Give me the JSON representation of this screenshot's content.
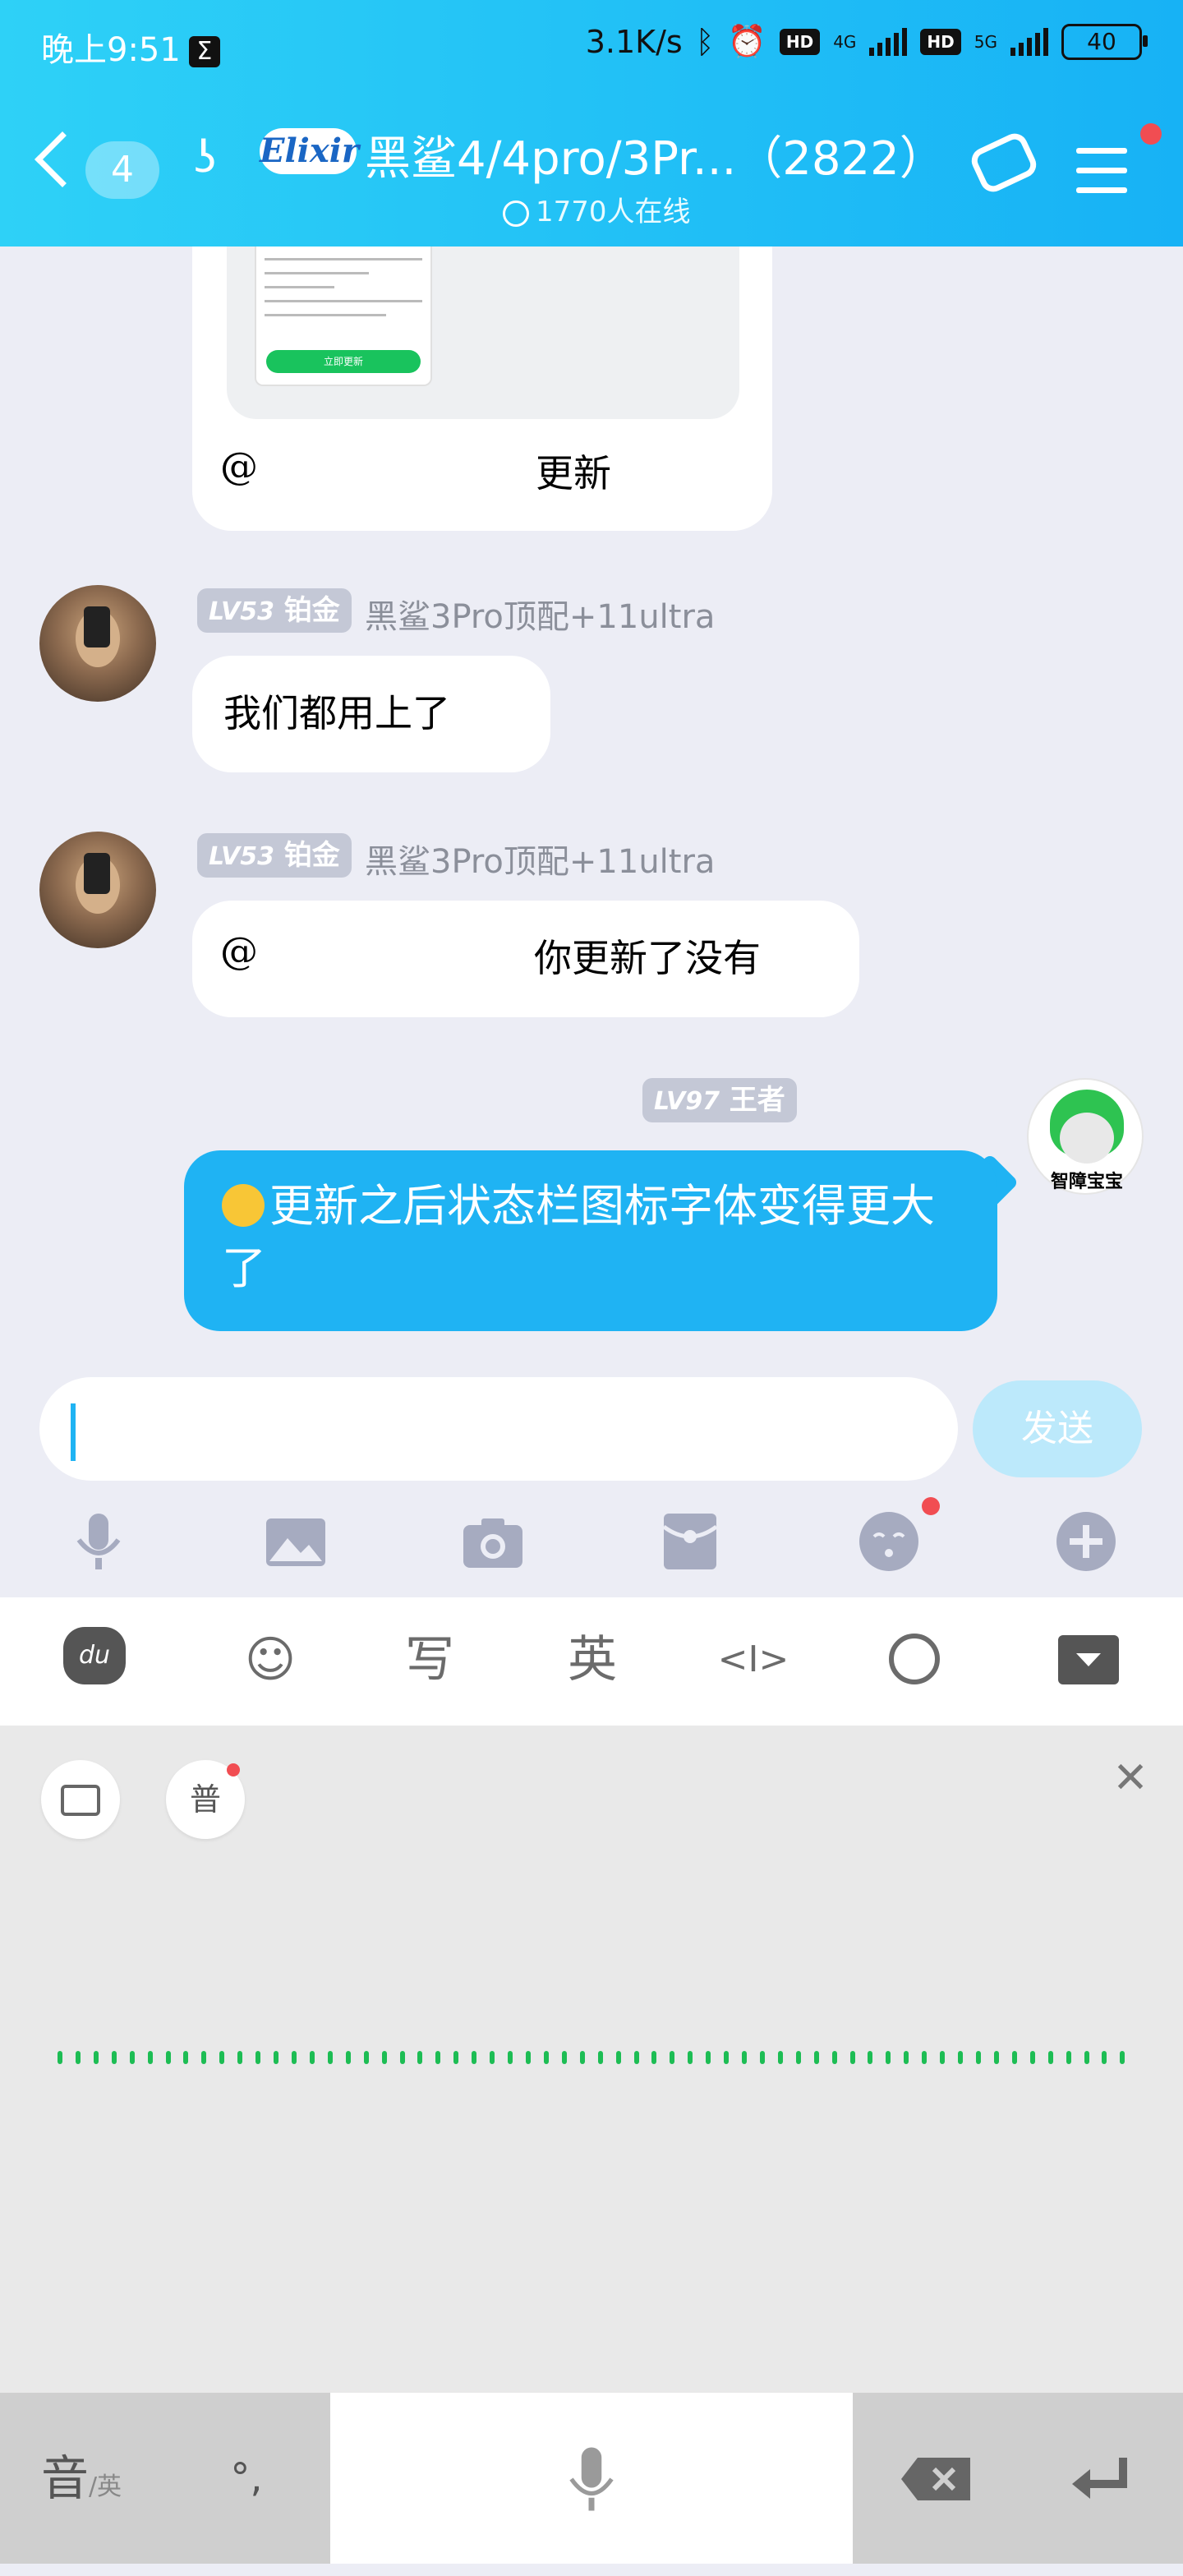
{
  "status_bar": {
    "time": "晚上9:51",
    "sigma": "Σ",
    "speed": "3.1K/s",
    "network_4g": "4G",
    "network_5g": "5G",
    "hd": "HD",
    "battery": "40"
  },
  "header": {
    "back_count": "4",
    "logo_text": "Elixir",
    "title": "黑鲨4/4pro/3Pr...（2822）",
    "online": "1770人在线"
  },
  "messages": [
    {
      "type": "card",
      "at": "@",
      "text": "更新",
      "card_button": "立即更新"
    },
    {
      "type": "incoming",
      "level": "LV53",
      "rank": "铂金",
      "sender": "黑鲨3Pro顶配+11ultra",
      "text": "我们都用上了"
    },
    {
      "type": "incoming",
      "level": "LV53",
      "rank": "铂金",
      "sender": "黑鲨3Pro顶配+11ultra",
      "at": "@",
      "text": "你更新了没有"
    },
    {
      "type": "outgoing",
      "level": "LV97",
      "rank": "王者",
      "avatar_label": "智障宝宝",
      "text": "更新之后状态栏图标字体变得更大了"
    }
  ],
  "input": {
    "value": "",
    "send_label": "发送"
  },
  "toolbar": {
    "items": [
      "microphone-icon",
      "image-icon",
      "camera-icon",
      "red-envelope-icon",
      "emoji-icon",
      "plus-icon"
    ]
  },
  "keyboard": {
    "top_row": {
      "du": "du",
      "write": "写",
      "english": "英",
      "cursor": "<I>"
    },
    "chips": {
      "mandarin": "普"
    },
    "bottom": {
      "lang_main": "音",
      "lang_sub": "/英",
      "punct": "°,"
    }
  },
  "colors": {
    "header_start": "#2ed1f7",
    "header_end": "#17b2f5",
    "my_bubble": "#1fb3f3",
    "wave": "#1dbd54",
    "badge_red": "#f14d52"
  }
}
